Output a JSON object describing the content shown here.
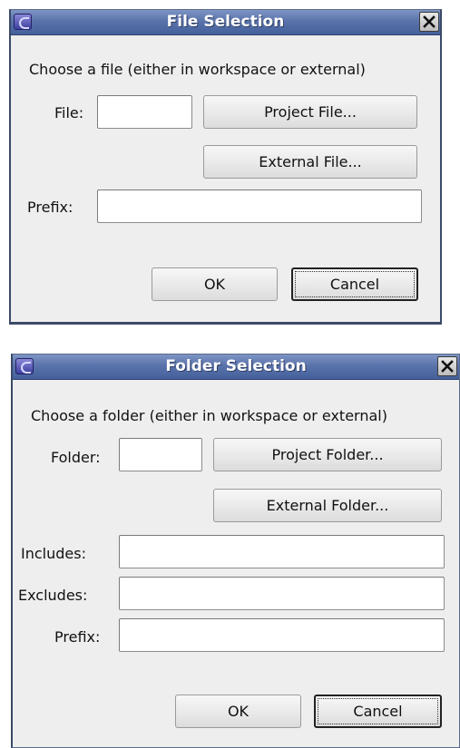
{
  "file_dialog": {
    "title": "File Selection",
    "prompt": "Choose a file (either in workspace or external)",
    "file_label": "File:",
    "project_file_button": "Project File...",
    "external_file_button": "External File...",
    "prefix_label": "Prefix:",
    "ok_button": "OK",
    "cancel_button": "Cancel"
  },
  "folder_dialog": {
    "title": "Folder Selection",
    "prompt": "Choose a folder (either in workspace or external)",
    "folder_label": "Folder:",
    "project_folder_button": "Project Folder...",
    "external_folder_button": "External Folder...",
    "includes_label": "Includes:",
    "excludes_label": "Excludes:",
    "prefix_label": "Prefix:",
    "ok_button": "OK",
    "cancel_button": "Cancel"
  },
  "icons": {
    "app": "eclipse-icon",
    "close": "close-icon"
  },
  "colors": {
    "titlebar": "#5a73ab",
    "dialog_bg": "#eeeeee",
    "field_bg": "#ffffff"
  }
}
